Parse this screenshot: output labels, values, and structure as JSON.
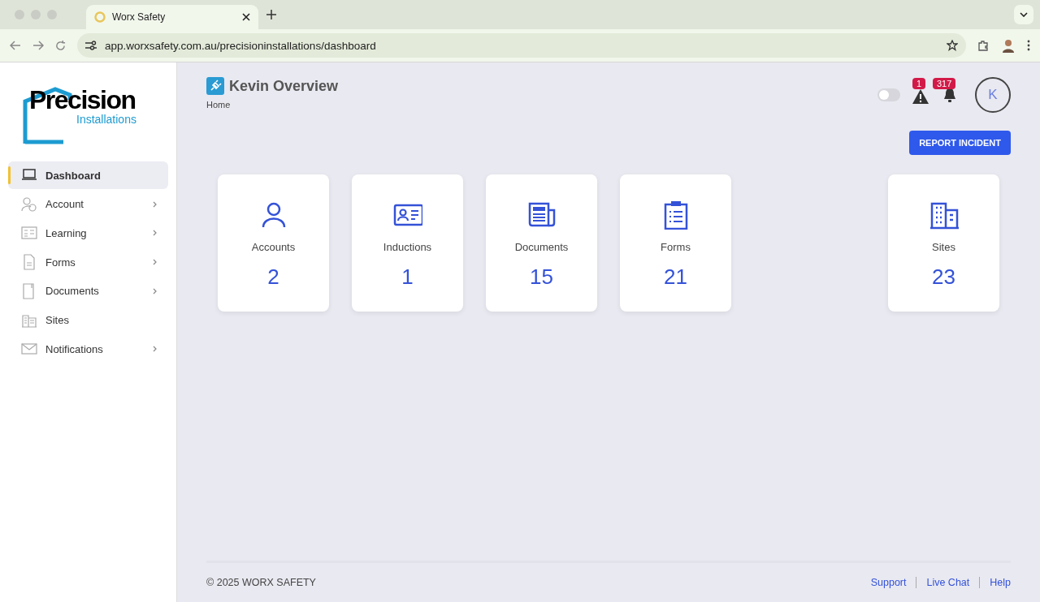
{
  "browser": {
    "tab_title": "Worx Safety",
    "url": "app.worxsafety.com.au/precisioninstallations/dashboard"
  },
  "logo": {
    "name": "Precision",
    "tagline": "Installations"
  },
  "sidebar": {
    "items": [
      {
        "label": "Dashboard",
        "selected": true,
        "submenu": false
      },
      {
        "label": "Account",
        "selected": false,
        "submenu": true
      },
      {
        "label": "Learning",
        "selected": false,
        "submenu": true
      },
      {
        "label": "Forms",
        "selected": false,
        "submenu": true
      },
      {
        "label": "Documents",
        "selected": false,
        "submenu": true
      },
      {
        "label": "Sites",
        "selected": false,
        "submenu": false
      },
      {
        "label": "Notifications",
        "selected": false,
        "submenu": true
      }
    ]
  },
  "header": {
    "title": "Kevin Overview",
    "breadcrumb": "Home",
    "toggle": {
      "on": false
    },
    "alerts_badge": "1",
    "notifications_badge": "317",
    "avatar": "K",
    "report_button": "REPORT INCIDENT"
  },
  "cards": [
    {
      "label": "Accounts",
      "value": "2"
    },
    {
      "label": "Inductions",
      "value": "1"
    },
    {
      "label": "Documents",
      "value": "15"
    },
    {
      "label": "Forms",
      "value": "21"
    },
    {
      "label": "Sites",
      "value": "23"
    }
  ],
  "footer": {
    "copyright": "© 2025 WORX SAFETY",
    "links": [
      "Support",
      "Live Chat",
      "Help"
    ]
  }
}
